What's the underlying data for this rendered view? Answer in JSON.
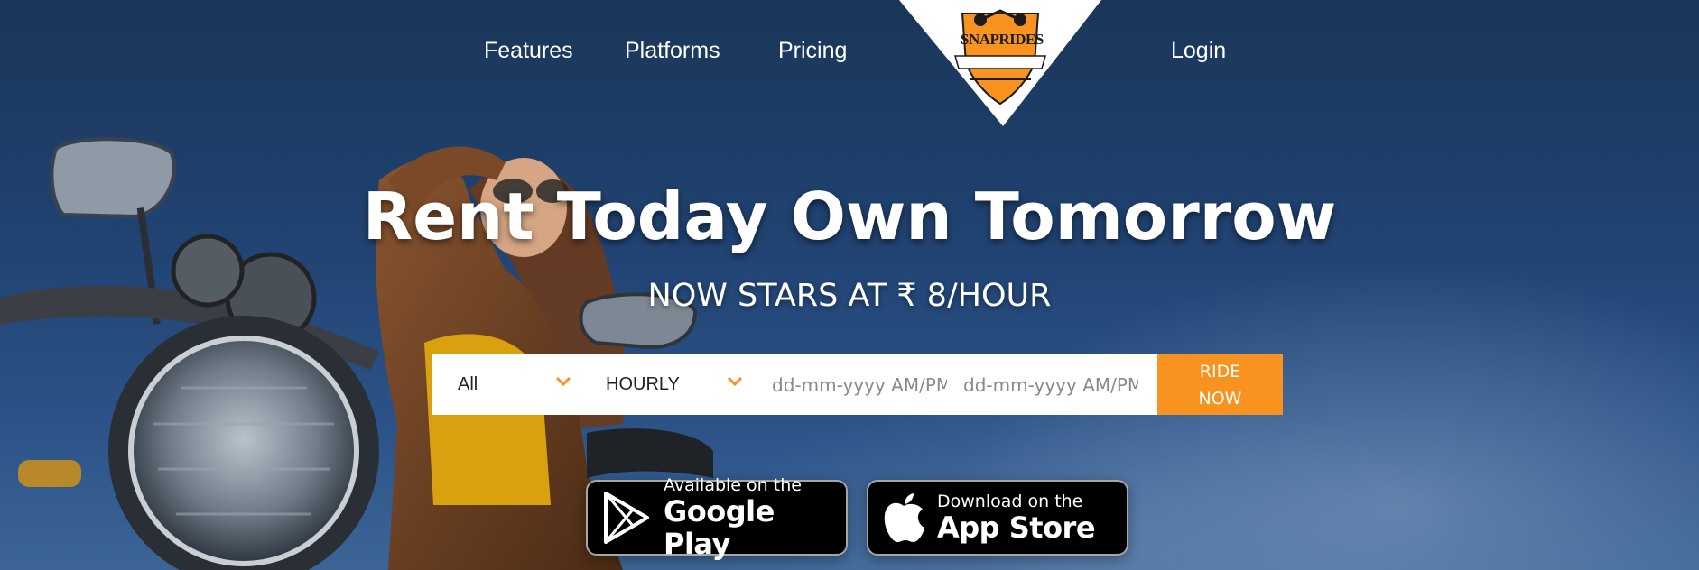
{
  "nav": {
    "features": "Features",
    "platforms": "Platforms",
    "pricing": "Pricing",
    "login": "Login"
  },
  "logo": {
    "text": "SNAPRIDES"
  },
  "hero": {
    "headline": "Rent Today Own Tomorrow",
    "subline": "NOW STARS AT ₹ 8/HOUR"
  },
  "search": {
    "category": "All",
    "duration": "HOURLY",
    "start_placeholder": "dd-mm-yyyy AM/PM",
    "end_placeholder": "dd-mm-yyyy AM/PM",
    "button_line1": "RIDE",
    "button_line2": "NOW"
  },
  "badges": {
    "google_small": "Available on the",
    "google_big": "Google Play",
    "apple_small": "Download on the",
    "apple_big": "App Store"
  },
  "colors": {
    "accent": "#f7931e",
    "sky": "#214474",
    "text": "#ffffff"
  }
}
